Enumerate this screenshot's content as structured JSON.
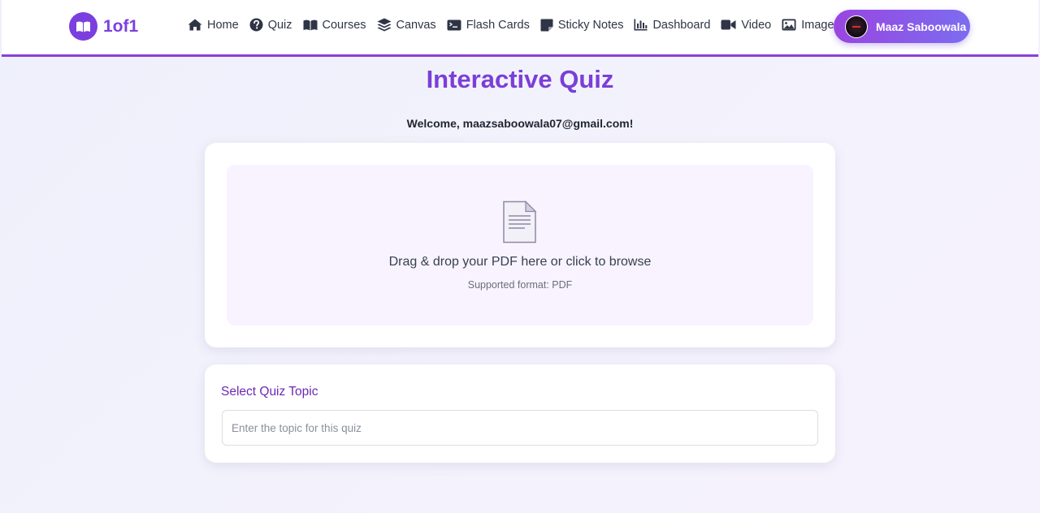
{
  "brand": {
    "name": "1of1",
    "icon": "book-open-icon",
    "color": "#7b3fe0"
  },
  "nav": {
    "items": [
      {
        "label": "Home",
        "icon": "home-icon"
      },
      {
        "label": "Quiz",
        "icon": "question-circle-icon"
      },
      {
        "label": "Courses",
        "icon": "book-icon"
      },
      {
        "label": "Canvas",
        "icon": "layers-icon"
      },
      {
        "label": "Flash Cards",
        "icon": "terminal-card-icon"
      },
      {
        "label": "Sticky Notes",
        "icon": "sticky-note-icon"
      },
      {
        "label": "Dashboard",
        "icon": "bar-chart-icon"
      },
      {
        "label": "Video",
        "icon": "video-camera-icon"
      },
      {
        "label": "Image",
        "icon": "image-icon"
      }
    ]
  },
  "profile": {
    "name": "Maaz Saboowala",
    "avatar": "avatar"
  },
  "page": {
    "title": "Interactive Quiz",
    "welcome": "Welcome, maazsaboowala07@gmail.com!"
  },
  "upload": {
    "icon": "document-icon",
    "text": "Drag & drop your PDF here or click to browse",
    "subtext": "Supported format: PDF"
  },
  "topic": {
    "label": "Select Quiz Topic",
    "placeholder": "Enter the topic for this quiz",
    "value": ""
  },
  "colors": {
    "accent": "#7b3fd6",
    "nav_border": "#8b3fd6",
    "profile_gradient_start": "#9a45e0",
    "profile_gradient_end": "#7b6cf0",
    "dropzone_bg": "#f8f3fe"
  }
}
